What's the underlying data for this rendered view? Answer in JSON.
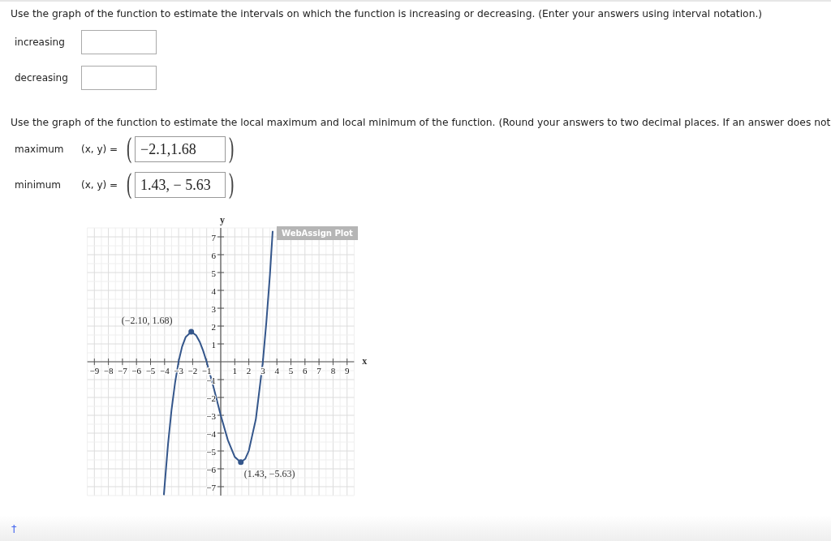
{
  "question_1": {
    "prompt": "Use the graph of the function to estimate the intervals on which the function is increasing or decreasing. (Enter your answers using interval notation.)",
    "answers": [
      {
        "label": "increasing"
      },
      {
        "label": "decreasing"
      }
    ]
  },
  "question_2": {
    "prompt": "Use the graph of the function to estimate the local maximum and local minimum of the function. (Round your answers to two decimal places. If an answer does not",
    "answers": [
      {
        "label": "maximum",
        "prefix": "(x, y) =",
        "open": "(",
        "value": "−2.1,1.68",
        "close": ")"
      },
      {
        "label": "minimum",
        "prefix": "(x, y) =",
        "open": "(",
        "value": "1.43, − 5.63",
        "close": ")"
      }
    ]
  },
  "plot": {
    "badge": "WebAssign Plot",
    "chart_data": {
      "type": "line",
      "xlabel": "x",
      "ylabel": "y",
      "x": [
        -4.05,
        -3.75,
        -3.5,
        -3.25,
        -3,
        -2.75,
        -2.5,
        -2.1,
        -1.75,
        -1.5,
        -1.25,
        -1,
        -0.5,
        0,
        0.5,
        1,
        1.43,
        1.75,
        2,
        2.5,
        3,
        3.25,
        3.5,
        3.7
      ],
      "series": [
        {
          "color": "#34568b",
          "values": [
            -7.47,
            -4.6,
            -2.68,
            -1.15,
            0.02,
            0.85,
            1.38,
            1.68,
            1.48,
            1.12,
            0.61,
            -0.01,
            -1.46,
            -3.0,
            -4.38,
            -5.33,
            -5.63,
            -5.44,
            -4.99,
            -3.21,
            -0.01,
            2.21,
            4.86,
            7.33
          ]
        }
      ],
      "grid": true,
      "xlim": [
        -9.5,
        9.5
      ],
      "ylim": [
        -7.5,
        7.5
      ],
      "xticks": [
        {
          "value": -9,
          "label": "−9"
        },
        {
          "value": -8,
          "label": "−8"
        },
        {
          "value": -7,
          "label": "−7"
        },
        {
          "value": -6,
          "label": "−6"
        },
        {
          "value": -5,
          "label": "−5"
        },
        {
          "value": -4,
          "label": "−4"
        },
        {
          "value": -3,
          "label": "−3"
        },
        {
          "value": -2,
          "label": "−2"
        },
        {
          "value": -1,
          "label": "−1"
        },
        1,
        2,
        3,
        4,
        5,
        6,
        7,
        8,
        9
      ],
      "yticks": [
        {
          "value": -7,
          "label": "−7"
        },
        {
          "value": -6,
          "label": "−6"
        },
        {
          "value": -5,
          "label": "−5"
        },
        {
          "value": -4,
          "label": "−4"
        },
        {
          "value": -3,
          "label": "−3"
        },
        {
          "value": -2,
          "label": "−2"
        },
        {
          "value": -1,
          "label": "−1"
        },
        1,
        2,
        3,
        4,
        5,
        6,
        7
      ],
      "annotations": [
        {
          "text": "(−2.10, 1.68)",
          "x": -2.1,
          "y": 1.68
        },
        {
          "text": "(1.43, −5.63)",
          "x": 1.43,
          "y": -5.63
        }
      ]
    }
  },
  "footer": {
    "mark": "†"
  }
}
